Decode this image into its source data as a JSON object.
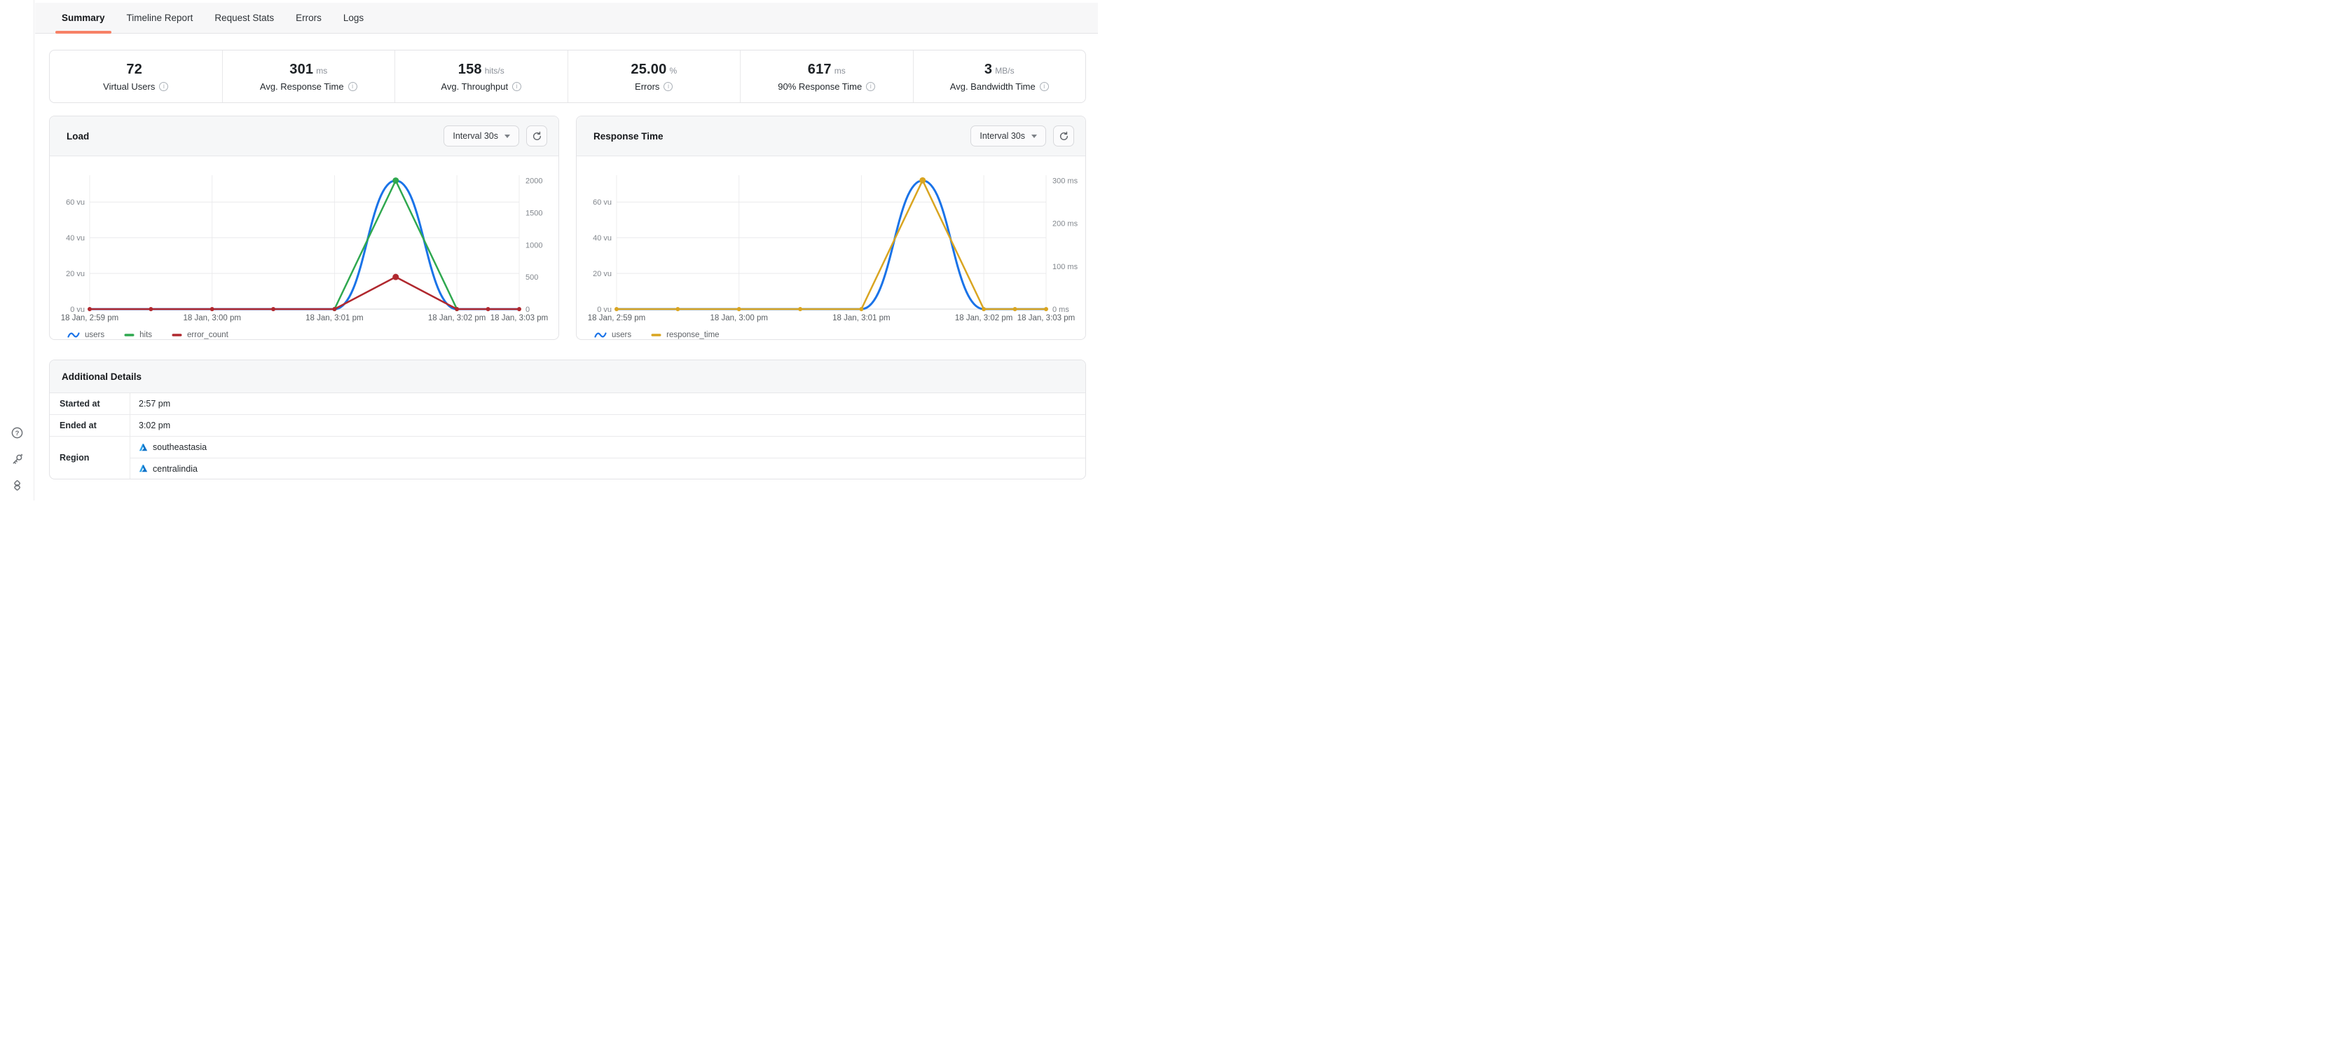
{
  "tabs": {
    "items": [
      {
        "label": "Summary",
        "active": true
      },
      {
        "label": "Timeline Report",
        "active": false
      },
      {
        "label": "Request Stats",
        "active": false
      },
      {
        "label": "Errors",
        "active": false
      },
      {
        "label": "Logs",
        "active": false
      }
    ]
  },
  "stats": {
    "cards": [
      {
        "value": "72",
        "unit": "",
        "label": "Virtual Users"
      },
      {
        "value": "301",
        "unit": "ms",
        "label": "Avg. Response Time"
      },
      {
        "value": "158",
        "unit": "hits/s",
        "label": "Avg. Throughput"
      },
      {
        "value": "25.00",
        "unit": "%",
        "label": "Errors"
      },
      {
        "value": "617",
        "unit": "ms",
        "label": "90% Response Time"
      },
      {
        "value": "3",
        "unit": "MB/s",
        "label": "Avg. Bandwidth Time"
      }
    ]
  },
  "chart_data": [
    {
      "id": "load",
      "type": "line",
      "title": "Load",
      "interval_label": "Interval 30s",
      "x_points": [
        "2:59:00",
        "2:59:30",
        "3:00:00",
        "3:00:30",
        "3:01:00",
        "3:01:30",
        "3:02:00",
        "3:02:30",
        "3:03:00"
      ],
      "x_labels": [
        "18 Jan, 2:59 pm",
        "18 Jan, 3:00 pm",
        "18 Jan, 3:01 pm",
        "18 Jan, 3:02 pm",
        "18 Jan, 3:03 pm"
      ],
      "left_axis": {
        "ticks": [
          "0 vu",
          "20 vu",
          "40 vu",
          "60 vu"
        ],
        "tick_values": [
          0,
          20,
          40,
          60
        ],
        "max": 75
      },
      "right_axis": {
        "ticks": [
          "0",
          "500",
          "1000",
          "1500",
          "2000"
        ],
        "tick_values": [
          0,
          500,
          1000,
          1500,
          2000
        ],
        "max": 2083
      },
      "series": [
        {
          "name": "users",
          "color": "#1a73e8",
          "axis": "left",
          "style": "smooth",
          "values": [
            0,
            0,
            0,
            0,
            0,
            72,
            0,
            0,
            0
          ]
        },
        {
          "name": "hits",
          "color": "#2fa84f",
          "axis": "right",
          "style": "linear",
          "values": [
            null,
            null,
            null,
            null,
            0,
            2000,
            0,
            null,
            null
          ]
        },
        {
          "name": "error_count",
          "color": "#b0282e",
          "axis": "right",
          "style": "linear",
          "values": [
            0,
            0,
            0,
            0,
            0,
            500,
            0,
            0,
            0
          ]
        }
      ],
      "legend": [
        "users",
        "hits",
        "error_count"
      ]
    },
    {
      "id": "response",
      "type": "line",
      "title": "Response Time",
      "interval_label": "Interval 30s",
      "x_points": [
        "2:59:00",
        "2:59:30",
        "3:00:00",
        "3:00:30",
        "3:01:00",
        "3:01:30",
        "3:02:00",
        "3:02:30",
        "3:03:00"
      ],
      "x_labels": [
        "18 Jan, 2:59 pm",
        "18 Jan, 3:00 pm",
        "18 Jan, 3:01 pm",
        "18 Jan, 3:02 pm",
        "18 Jan, 3:03 pm"
      ],
      "left_axis": {
        "ticks": [
          "0 vu",
          "20 vu",
          "40 vu",
          "60 vu"
        ],
        "tick_values": [
          0,
          20,
          40,
          60
        ],
        "max": 75
      },
      "right_axis": {
        "ticks": [
          "0 ms",
          "100 ms",
          "200 ms",
          "300 ms"
        ],
        "tick_values": [
          0,
          100,
          200,
          300
        ],
        "max": 312
      },
      "series": [
        {
          "name": "users",
          "color": "#1a73e8",
          "axis": "left",
          "style": "smooth",
          "values": [
            0,
            0,
            0,
            0,
            0,
            72,
            0,
            0,
            0
          ]
        },
        {
          "name": "response_time",
          "color": "#d9a521",
          "axis": "right",
          "style": "linear",
          "values": [
            0,
            0,
            0,
            0,
            0,
            300,
            0,
            0,
            0
          ]
        }
      ],
      "legend": [
        "users",
        "response_time"
      ]
    }
  ],
  "details": {
    "title": "Additional Details",
    "rows": [
      {
        "label": "Started at",
        "value": "2:57 pm"
      },
      {
        "label": "Ended at",
        "value": "3:02 pm"
      },
      {
        "label": "Region",
        "values": [
          "southeastasia",
          "centralindia"
        ]
      }
    ]
  },
  "sidebar": {
    "icons": [
      "help-icon",
      "key-icon",
      "layers-icon"
    ]
  },
  "colors": {
    "accent_tab_underline": "#f78166",
    "users_line": "#1a73e8",
    "hits_line": "#2fa84f",
    "error_line": "#b0282e",
    "response_time_line": "#d9a521",
    "header_bg": "#f6f7f8"
  }
}
